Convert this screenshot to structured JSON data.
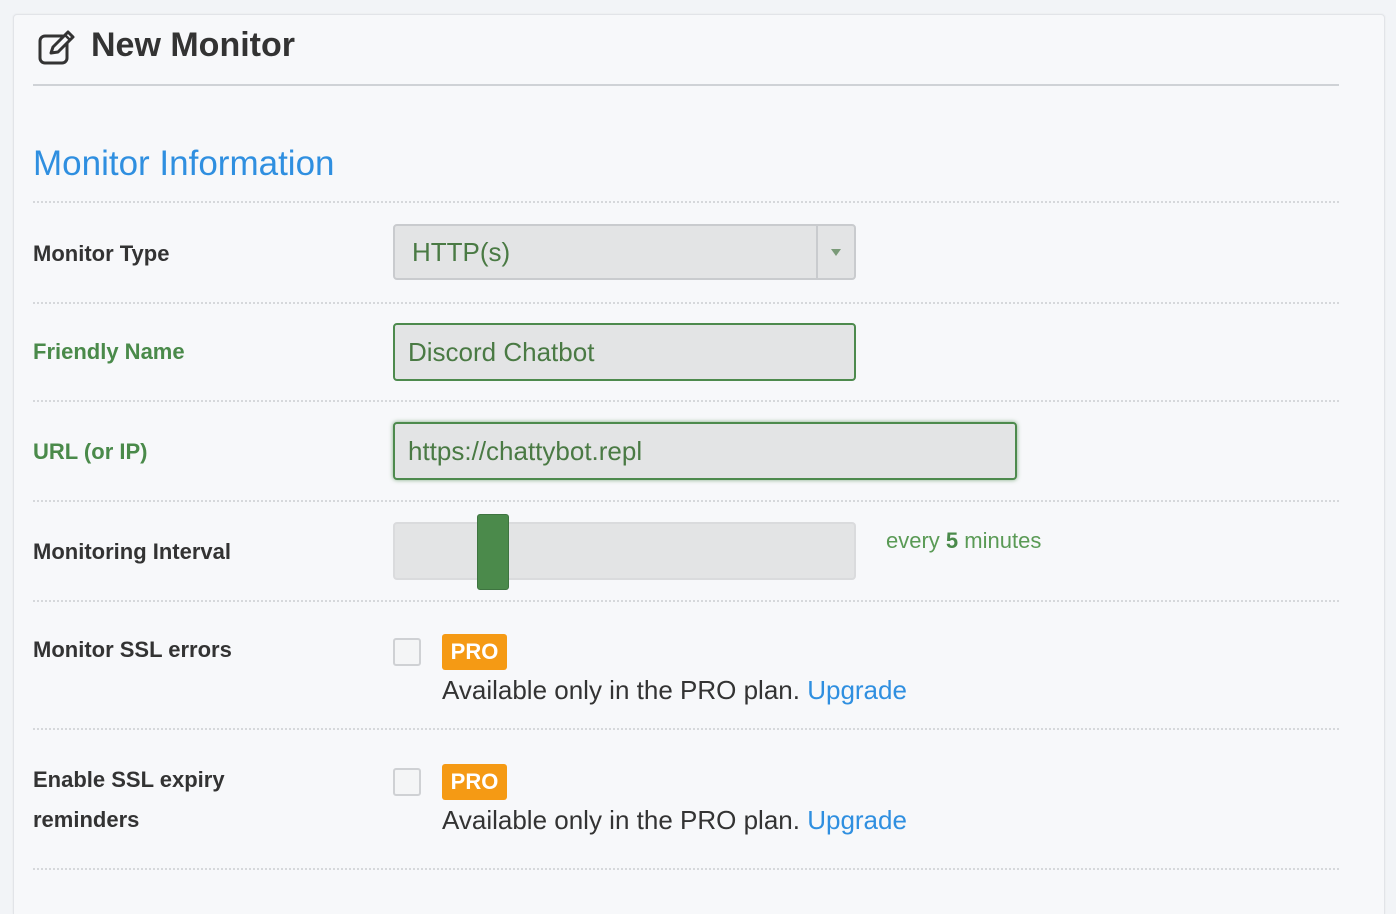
{
  "header": {
    "title": "New Monitor",
    "icon": "edit-icon"
  },
  "section": {
    "title": "Monitor Information"
  },
  "fields": {
    "monitor_type": {
      "label": "Monitor Type",
      "value": "HTTP(s)",
      "icon": "chevron-down-icon"
    },
    "friendly_name": {
      "label": "Friendly Name",
      "value": "Discord Chatbot"
    },
    "url": {
      "label": "URL (or IP)",
      "value": "https://chattybot.repl"
    },
    "interval": {
      "label": "Monitoring Interval",
      "prefix": "every",
      "value": "5",
      "suffix": "minutes",
      "level": 0.2
    },
    "ssl_errors": {
      "label": "Monitor SSL errors",
      "checked": false,
      "badge": "PRO",
      "note": "Available only in the PRO plan.",
      "link": "Upgrade"
    },
    "ssl_expiry": {
      "label_line1": "Enable SSL expiry",
      "label_line2": "reminders",
      "checked": false,
      "badge": "PRO",
      "note": "Available only in the PRO plan.",
      "link": "Upgrade"
    }
  },
  "colors": {
    "accent_blue": "#2f8fe0",
    "valid_green": "#4b8a4b",
    "pro_orange": "#f59a14"
  }
}
